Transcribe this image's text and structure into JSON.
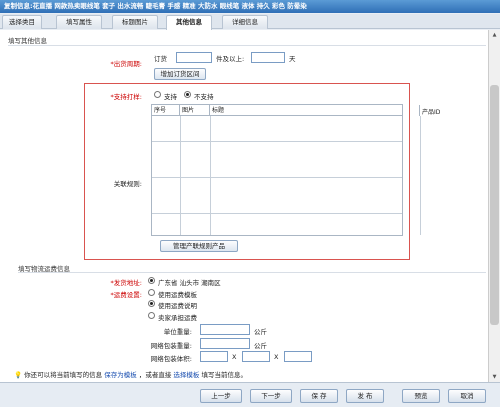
{
  "window": {
    "title": "复制信息:花直播 网款热卖眼线笔 套子 出水流畅 睫毛膏 手感 精准 大防水 眼线笔 液体 持久 彩色 防晕染"
  },
  "tabs": [
    {
      "label": "选择类目"
    },
    {
      "label": "填写属性"
    },
    {
      "label": "标题图片"
    },
    {
      "label": "其他信息",
      "active": true
    },
    {
      "label": "详细信息"
    }
  ],
  "other_info": {
    "section_title": "填写其他信息",
    "ship_period": {
      "label": "出货周期:",
      "order_label": "订货",
      "mid_label": "件及以上:",
      "unit": "天",
      "add_button": "增加订货区间"
    },
    "dropship": {
      "label": "支持打样:",
      "option_yes": "支持",
      "option_no": "不支持",
      "selected": "不支持"
    },
    "related": {
      "label": "关联规则:",
      "columns": [
        "序号",
        "图片",
        "标题",
        "产品ID"
      ],
      "manage_button": "管理产联规则产品"
    }
  },
  "logistics": {
    "section_title": "填写物流运费信息",
    "ship_addr_label": "发货地址:",
    "ship_addr_value": "广东省 汕头市 潮南区",
    "fee_label": "运费设置:",
    "fee_options": [
      "使用运费模板",
      "使用运费说明",
      "卖家承担运费"
    ],
    "fee_selected": "使用运费说明",
    "unit_weight_label": "单位重量:",
    "pack_weight_label": "网络包装重量:",
    "pack_volume_label": "网络包装体积:",
    "weight_unit": "公斤",
    "times": "X"
  },
  "tip": {
    "text1": "你还可以将当前填写的信息",
    "save_template": "保存为模板",
    "text2": "，或者直接",
    "choose_template": "选择模板",
    "text3": "填写当前信息。"
  },
  "footer": {
    "prev": "上一步",
    "next": "下一步",
    "save": "保 存",
    "publish": "发 布",
    "preview": "预览",
    "cancel": "取消"
  }
}
